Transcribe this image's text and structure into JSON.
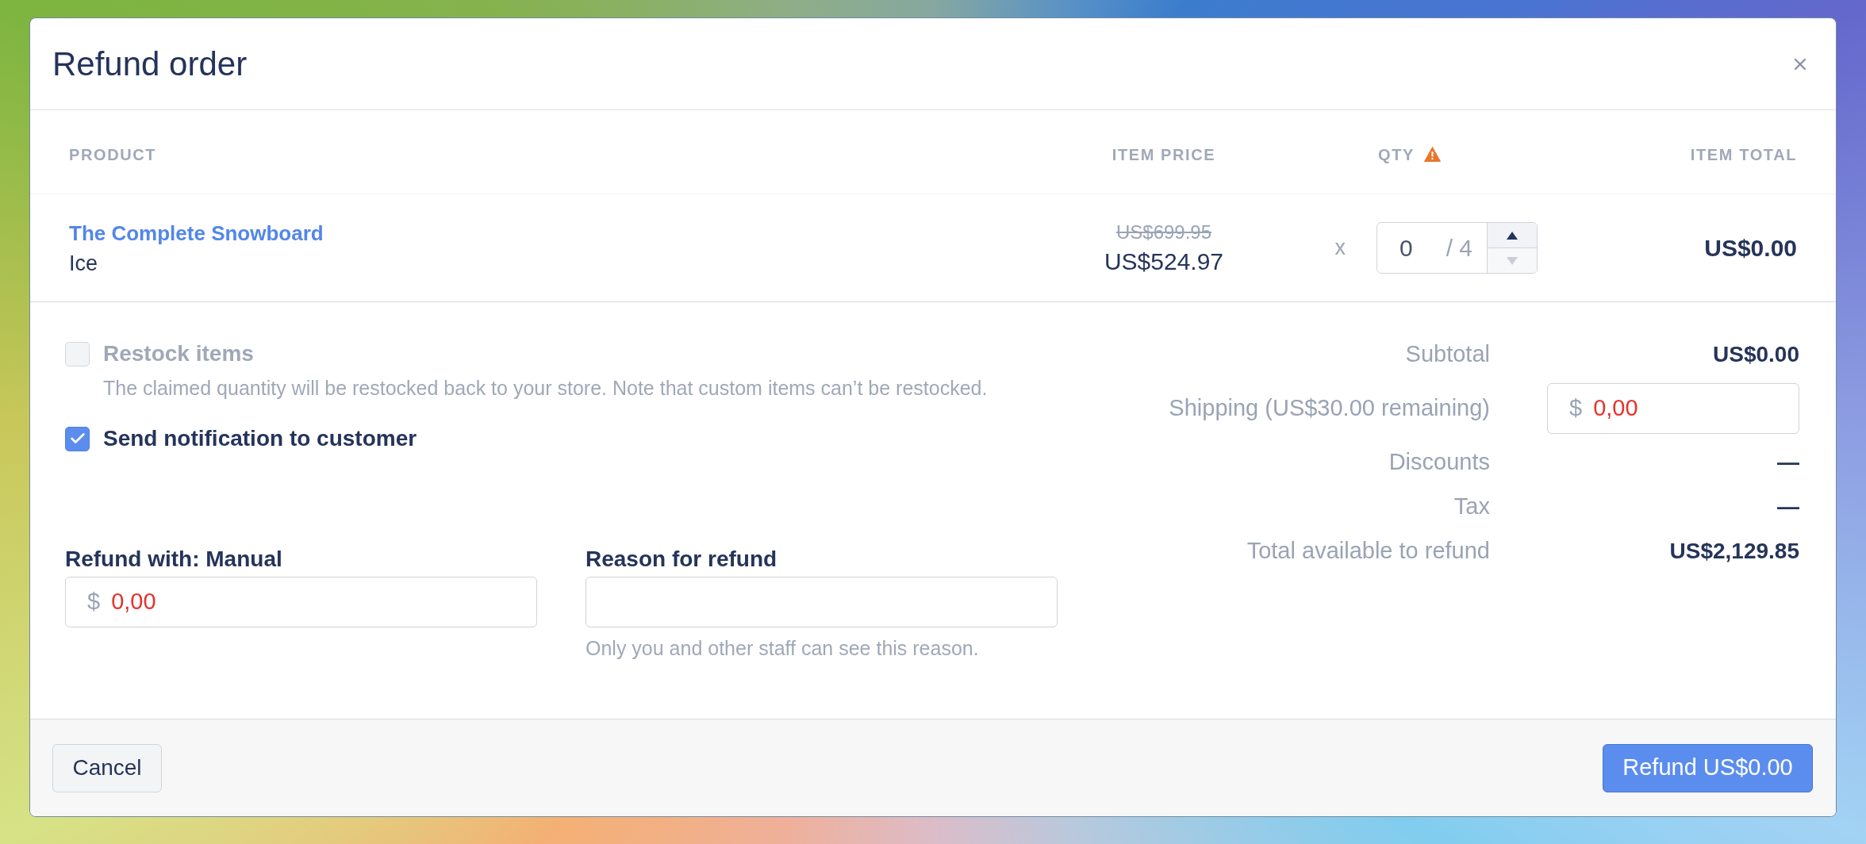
{
  "dialog": {
    "title": "Refund order"
  },
  "table": {
    "columns": [
      {
        "label": "PRODUCT",
        "warning": false
      },
      {
        "label": "ITEM PRICE",
        "warning": false
      },
      {
        "label": "QTY",
        "warning": true
      },
      {
        "label": "ITEM TOTAL",
        "warning": false
      }
    ],
    "rows": [
      {
        "product": "The Complete Snowboard",
        "variant": "Ice",
        "original_price": "US$699.95",
        "price": "US$524.97",
        "times": "x",
        "quantity": {
          "value": "0",
          "of_total": "/ 4",
          "increase_disabled": false,
          "decrease_disabled": true
        },
        "total": "US$0.00"
      }
    ]
  },
  "options": [
    {
      "label": "Restock items",
      "checked": false,
      "disabled": true,
      "description": "The claimed quantity will be restocked back to your store. Note that custom items can’t be restocked."
    },
    {
      "label": "Send notification to customer",
      "checked": true,
      "disabled": false
    }
  ],
  "refund_fields": [
    {
      "kind": "amount",
      "label": "Refund with: Manual",
      "prefix": "$",
      "value": "0,00",
      "error": true
    },
    {
      "kind": "text",
      "label": "Reason for refund",
      "help": "Only you and other staff can see this reason."
    }
  ],
  "summary": [
    {
      "kind": "text",
      "label": "Subtotal",
      "value": "US$0.00"
    },
    {
      "kind": "input",
      "label": "Shipping (US$30.00 remaining)",
      "prefix": "$",
      "value": "0,00",
      "error": true
    },
    {
      "kind": "text",
      "label": "Discounts",
      "value": "—"
    },
    {
      "kind": "text",
      "label": "Tax",
      "value": "—"
    },
    {
      "kind": "text",
      "label": "Total available to refund",
      "value": "US$2,129.85"
    }
  ],
  "footer": {
    "buttons": [
      {
        "kind": "secondary",
        "label": "Cancel"
      },
      {
        "kind": "primary",
        "label": "Refund US$0.00"
      }
    ]
  }
}
